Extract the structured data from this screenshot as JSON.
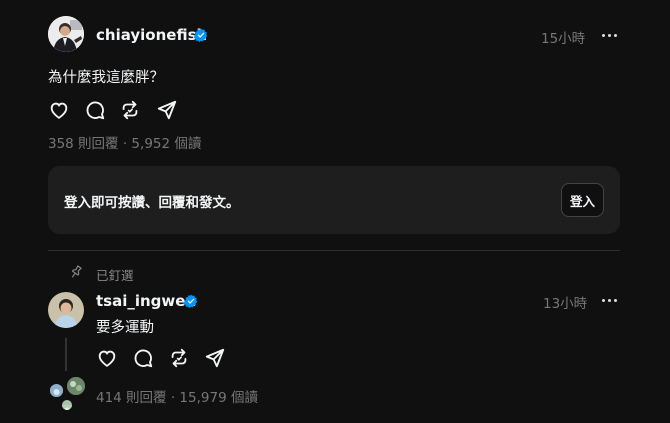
{
  "post": {
    "username": "chiayionefish",
    "time": "15小時",
    "text": "為什麼我這麼胖？",
    "stats": "358 則回覆 · 5,952 個讀"
  },
  "login": {
    "text": "登入即可按讚、回覆和發文。",
    "button": "登入"
  },
  "pinned_label": "已釘選",
  "reply": {
    "username": "tsai_ingwen",
    "time": "13小時",
    "text": "要多運動",
    "stats": "414 則回覆 · 15,979 個讀"
  },
  "colors": {
    "background": "#101010",
    "card": "#1e1e1e",
    "verified": "#0095f6",
    "muted": "#777777"
  },
  "icons": [
    "heart-icon",
    "comment-icon",
    "repost-icon",
    "share-icon",
    "more-icon",
    "verified-badge-icon",
    "pin-icon"
  ]
}
